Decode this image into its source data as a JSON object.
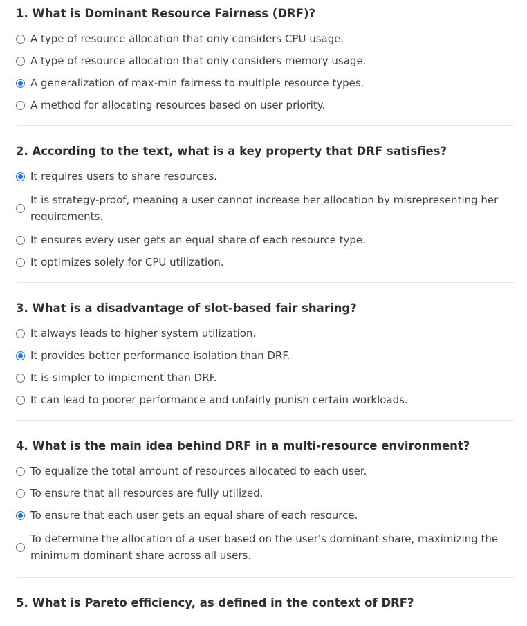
{
  "questions": [
    {
      "title": "1. What is Dominant Resource Fairness (DRF)?",
      "options": [
        {
          "text": "A type of resource allocation that only considers CPU usage.",
          "selected": false
        },
        {
          "text": "A type of resource allocation that only considers memory usage.",
          "selected": false
        },
        {
          "text": "A generalization of max-min fairness to multiple resource types.",
          "selected": true
        },
        {
          "text": "A method for allocating resources based on user priority.",
          "selected": false
        }
      ]
    },
    {
      "title": "2. According to the text, what is a key property that DRF satisfies?",
      "options": [
        {
          "text": "It requires users to share resources.",
          "selected": true
        },
        {
          "text": "It is strategy-proof, meaning a user cannot increase her allocation by misrepresenting her requirements.",
          "selected": false
        },
        {
          "text": "It ensures every user gets an equal share of each resource type.",
          "selected": false
        },
        {
          "text": "It optimizes solely for CPU utilization.",
          "selected": false
        }
      ]
    },
    {
      "title": "3. What is a disadvantage of slot-based fair sharing?",
      "options": [
        {
          "text": "It always leads to higher system utilization.",
          "selected": false
        },
        {
          "text": "It provides better performance isolation than DRF.",
          "selected": true
        },
        {
          "text": "It is simpler to implement than DRF.",
          "selected": false
        },
        {
          "text": "It can lead to poorer performance and unfairly punish certain workloads.",
          "selected": false
        }
      ]
    },
    {
      "title": "4. What is the main idea behind DRF in a multi-resource environment?",
      "options": [
        {
          "text": "To equalize the total amount of resources allocated to each user.",
          "selected": false
        },
        {
          "text": "To ensure that all resources are fully utilized.",
          "selected": false
        },
        {
          "text": "To ensure that each user gets an equal share of each resource.",
          "selected": true
        },
        {
          "text": "To determine the allocation of a user based on the user's dominant share, maximizing the minimum dominant share across all users.",
          "selected": false
        }
      ]
    },
    {
      "title": "5. What is Pareto efficiency, as defined in the context of DRF?",
      "options": []
    }
  ],
  "colors": {
    "accent": "#1a73e8",
    "text": "#3c4048",
    "title": "#2b2f36",
    "divider": "#e4e6ea"
  },
  "icons": {
    "selected": "radio-selected-icon",
    "unselected": "radio-unselected-icon"
  }
}
